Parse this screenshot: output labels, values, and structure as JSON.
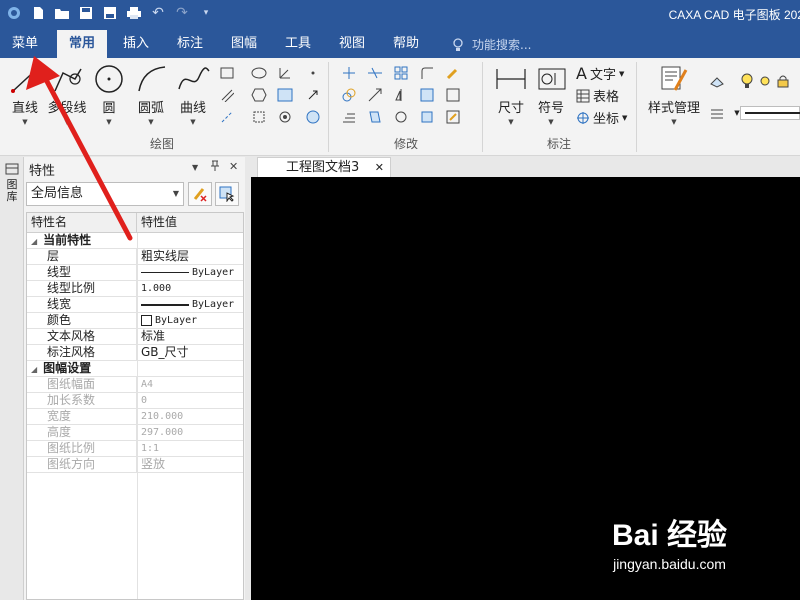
{
  "app_title": "CAXA CAD 电子图板 202",
  "qat": [
    "app-logo-icon",
    "new-file-icon",
    "open-folder-icon",
    "save-icon",
    "save-as-icon",
    "print-icon",
    "undo-icon",
    "redo-icon",
    "customize-icon"
  ],
  "tabs": [
    {
      "label": "菜单",
      "active": false
    },
    {
      "label": "常用",
      "active": true
    },
    {
      "label": "插入",
      "active": false
    },
    {
      "label": "标注",
      "active": false
    },
    {
      "label": "图幅",
      "active": false
    },
    {
      "label": "工具",
      "active": false
    },
    {
      "label": "视图",
      "active": false
    },
    {
      "label": "帮助",
      "active": false
    }
  ],
  "search": {
    "placeholder": "功能搜索..."
  },
  "ribbon": {
    "draw": {
      "label": "绘图",
      "buttons": [
        "直线",
        "多段线",
        "圆",
        "圆弧",
        "曲线"
      ]
    },
    "modify": {
      "label": "修改"
    },
    "annotate": {
      "label": "标注",
      "buttons": [
        "尺寸",
        "符号"
      ],
      "small": [
        "文字",
        "表格",
        "坐标"
      ]
    },
    "style": {
      "button": "样式管理"
    }
  },
  "left_strip": {
    "label": "图库"
  },
  "properties": {
    "title": "特性",
    "pin": "ꟷ",
    "close": "✕",
    "scope": "全局信息",
    "columns": [
      "特性名",
      "特性值"
    ],
    "sections": [
      {
        "name": "当前特性",
        "rows": [
          {
            "name": "层",
            "value": "粗实线层",
            "kind": "text"
          },
          {
            "name": "线型",
            "value": "ByLayer",
            "kind": "line"
          },
          {
            "name": "线型比例",
            "value": "1.000",
            "kind": "mono"
          },
          {
            "name": "线宽",
            "value": "ByLayer",
            "kind": "thick"
          },
          {
            "name": "颜色",
            "value": "ByLayer",
            "kind": "swatch"
          },
          {
            "name": "文本风格",
            "value": "标准",
            "kind": "text"
          },
          {
            "name": "标注风格",
            "value": "GB_尺寸",
            "kind": "text"
          }
        ]
      },
      {
        "name": "图幅设置",
        "rows": [
          {
            "name": "图纸幅面",
            "value": "A4"
          },
          {
            "name": "加长系数",
            "value": "0"
          },
          {
            "name": "宽度",
            "value": "210.000"
          },
          {
            "name": "高度",
            "value": "297.000"
          },
          {
            "name": "图纸比例",
            "value": "1:1"
          },
          {
            "name": "图纸方向",
            "value": "竖放"
          }
        ]
      }
    ]
  },
  "document": {
    "tab_label": "工程图文档3",
    "close": "✕"
  },
  "watermark": {
    "main": "Bai 经验",
    "sub": "jingyan.baidu.com"
  },
  "colors": {
    "title_bar": "#2b579a",
    "canvas": "#000000",
    "arrow": "#e0201c"
  }
}
